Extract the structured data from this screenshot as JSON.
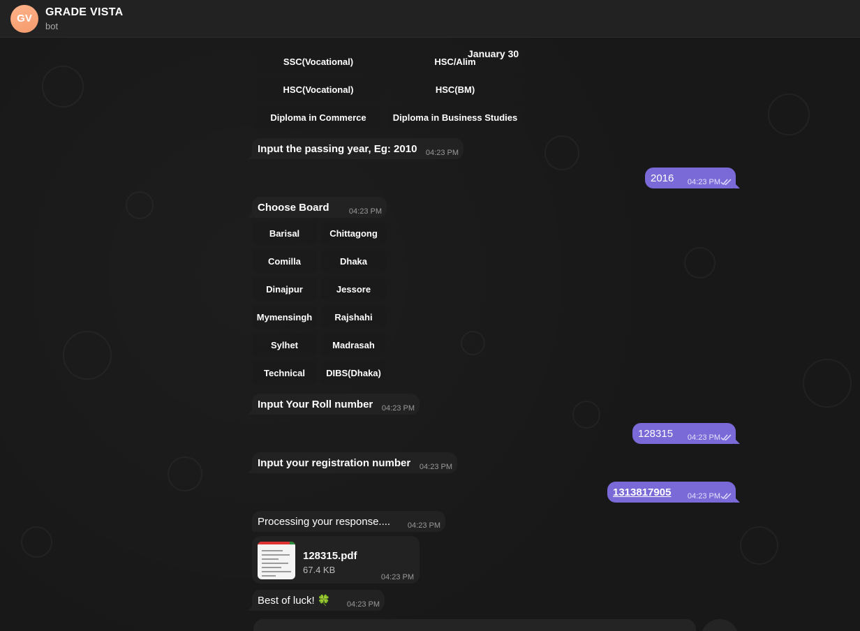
{
  "header": {
    "avatar_initials": "GV",
    "title": "GRADE VISTA",
    "subtitle": "bot"
  },
  "date_chip": "January 30",
  "group_keyboard": [
    [
      "SSC(Vocational)",
      "HSC/Alim"
    ],
    [
      "HSC(Vocational)",
      "HSC(BM)"
    ],
    [
      "Diploma in Commerce",
      "Diploma in Business Studies"
    ]
  ],
  "messages": {
    "passing_year_prompt": {
      "text": "Input the passing year, Eg: 2010",
      "time": "04:23 PM"
    },
    "year_reply": {
      "text": "2016",
      "time": "04:23 PM"
    },
    "choose_board": {
      "text": "Choose Board",
      "time": "04:23 PM"
    },
    "roll_prompt": {
      "text": "Input Your Roll number",
      "time": "04:23 PM"
    },
    "roll_reply": {
      "text": "128315",
      "time": "04:23 PM"
    },
    "reg_prompt": {
      "text": "Input your registration number",
      "time": "04:23 PM"
    },
    "reg_reply": {
      "text": "1313817905",
      "time": "04:23 PM"
    },
    "processing": {
      "text": "Processing your response....",
      "time": "04:23 PM"
    },
    "luck": {
      "text": "Best of luck! 🍀",
      "time": "04:23 PM"
    }
  },
  "board_keyboard": [
    [
      "Barisal",
      "Chittagong"
    ],
    [
      "Comilla",
      "Dhaka"
    ],
    [
      "Dinajpur",
      "Jessore"
    ],
    [
      "Mymensingh",
      "Rajshahi"
    ],
    [
      "Sylhet",
      "Madrasah"
    ],
    [
      "Technical",
      "DIBS(Dhaka)"
    ]
  ],
  "file": {
    "name": "128315.pdf",
    "size": "67.4 KB",
    "time": "04:23 PM",
    "icon": "pdf-thumbnail"
  },
  "colors": {
    "outgoing_bubble": "#7a6ad8",
    "incoming_bubble": "#222222",
    "avatar": "#f49a6c"
  }
}
